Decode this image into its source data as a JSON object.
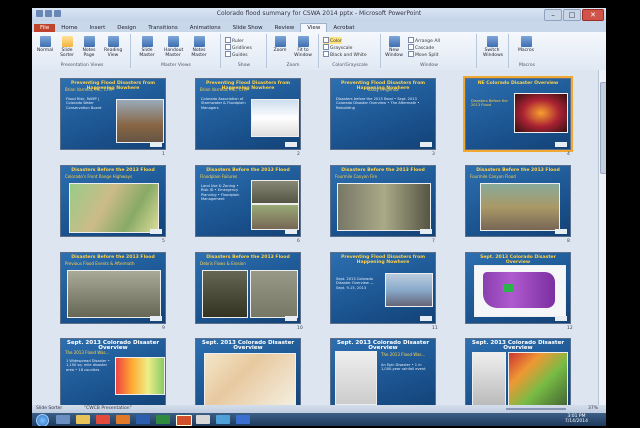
{
  "window": {
    "title": "Colorado flood summary for CSWA 2014 pptx - Microsoft PowerPoint",
    "buttons": {
      "minimize": "–",
      "maximize": "□",
      "close": "✕"
    }
  },
  "ribbon_tabs": [
    "File",
    "Home",
    "Insert",
    "Design",
    "Transitions",
    "Animations",
    "Slide Show",
    "Review",
    "View",
    "Acrobat"
  ],
  "active_tab": "View",
  "ribbon": {
    "groups": [
      {
        "label": "Presentation Views",
        "buttons": [
          "Normal",
          "Slide Sorter",
          "Notes Page",
          "Reading View"
        ]
      },
      {
        "label": "Master Views",
        "buttons": [
          "Slide Master",
          "Handout Master",
          "Notes Master"
        ]
      },
      {
        "label": "Show",
        "checks": [
          "Ruler",
          "Gridlines",
          "Guides"
        ]
      },
      {
        "label": "Zoom",
        "buttons": [
          "Zoom",
          "Fit to Window"
        ]
      },
      {
        "label": "Color/Grayscale",
        "checks": [
          "Color",
          "Grayscale",
          "Black and White"
        ]
      },
      {
        "label": "Window",
        "buttons": [
          "New Window"
        ],
        "checks": [
          "Arrange All",
          "Cascade",
          "Move Split"
        ]
      },
      {
        "label": "",
        "buttons": [
          "Switch Windows"
        ]
      },
      {
        "label": "Macros",
        "buttons": [
          "Macros"
        ]
      }
    ]
  },
  "slides": [
    {
      "num": "1",
      "title": "Preventing Flood Disasters from Happening Nowhere",
      "sub": "Brian Varrella, P.E., CFM",
      "body": "Flood Risk, RAMP | Colorado Water Conservation Board"
    },
    {
      "num": "2",
      "title": "Preventing Flood Disasters from Happening Nowhere",
      "sub": "Brian Varrella, P.E., CFM",
      "body": "Colorado Association of Stormwater & Floodplain Managers"
    },
    {
      "num": "3",
      "title": "Preventing Flood Disasters from Happening Nowhere",
      "sub": "Today's Agenda",
      "body": "Disasters before the 2013 flood • Sept. 2013 Colorado Disaster Overview • The Aftermath • Rebuilding"
    },
    {
      "num": "4",
      "title": "NE Colorado Disaster Overview",
      "sub": "",
      "body": "Disasters Before the 2013 Flood"
    },
    {
      "num": "5",
      "title": "Disasters Before the 2013 Flood",
      "sub": "Colorado's Front Range Highways",
      "body": ""
    },
    {
      "num": "6",
      "title": "Disasters Before the 2013 Flood",
      "sub": "Floodplain Failures",
      "body": "Land Use & Zoning • Risk ID • Emergency Planning • Floodplain Management"
    },
    {
      "num": "7",
      "title": "Disasters Before the 2013 Flood",
      "sub": "Fourmile Canyon Fire",
      "body": ""
    },
    {
      "num": "8",
      "title": "Disasters Before the 2013 Flood",
      "sub": "Fourmile Canyon Flood",
      "body": ""
    },
    {
      "num": "9",
      "title": "Disasters Before the 2013 Flood",
      "sub": "Previous Flood Events & Aftermath",
      "body": ""
    },
    {
      "num": "10",
      "title": "Disasters Before the 2013 Flood",
      "sub": "Debris Flows & Erosion",
      "body": ""
    },
    {
      "num": "11",
      "title": "Preventing Flood Disasters from Happening Nowhere",
      "sub": "",
      "body": "Sept. 2013 Colorado Disaster Overview — Sept. 9-15, 2013"
    },
    {
      "num": "12",
      "title": "Sept. 2013 Colorado Disaster Overview",
      "sub": "",
      "body": ""
    },
    {
      "num": "13",
      "title": "Sept. 2013 Colorado Disaster Overview",
      "sub": "The 2013 Flood Was...",
      "body": "1 Widespread Disaster • 1,100 sq. mile disaster area • 18 counties"
    },
    {
      "num": "14",
      "title": "Sept. 2013 Colorado Disaster Overview",
      "sub": "",
      "body": ""
    },
    {
      "num": "15",
      "title": "Sept. 2013 Colorado Disaster Overview",
      "sub": "The 2013 Flood Was...",
      "body": "An Epic Disaster • 1 in 1,000-year rainfall event"
    },
    {
      "num": "16",
      "title": "Sept. 2013 Colorado Disaster Overview",
      "sub": "",
      "body": ""
    }
  ],
  "status_bar": {
    "view": "Slide Sorter",
    "theme": "\"CWCB Presentation\"",
    "zoom": "37%"
  },
  "taskbar": {
    "time": "3:01 PM",
    "date": "7/14/2014"
  },
  "colors": {
    "slide_bg": "#1b5490",
    "title_yellow": "#ffd24a",
    "file_tab": "#c0432c"
  }
}
